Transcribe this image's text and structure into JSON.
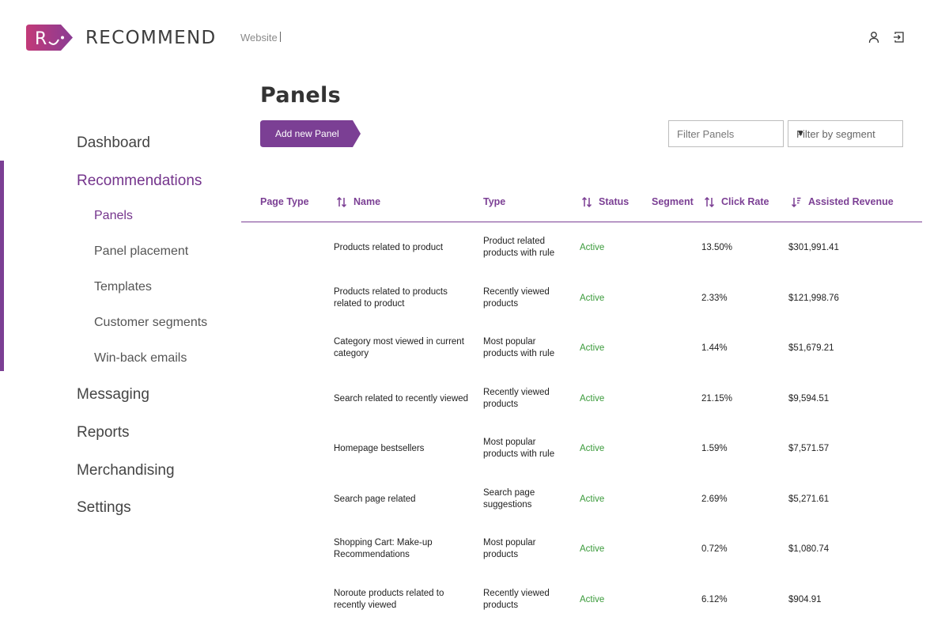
{
  "brand": {
    "logo_letter": "R",
    "name": "RECOMMEND"
  },
  "header": {
    "website_label": "Website"
  },
  "icons": {
    "user": "user-icon",
    "logout": "logout-icon",
    "sort": "sort-icon"
  },
  "colors": {
    "accent": "#7b3f94",
    "status_active": "#3a9a3a"
  },
  "sidebar": {
    "items": [
      {
        "label": "Dashboard"
      },
      {
        "label": "Recommendations",
        "active": true
      },
      {
        "label": "Messaging"
      },
      {
        "label": "Reports"
      },
      {
        "label": "Merchandising"
      },
      {
        "label": "Settings"
      }
    ],
    "subitems": [
      {
        "label": "Panels",
        "active": true
      },
      {
        "label": "Panel placement"
      },
      {
        "label": "Templates"
      },
      {
        "label": "Customer segments"
      },
      {
        "label": "Win-back emails"
      }
    ]
  },
  "main": {
    "title": "Panels",
    "add_button": "Add new Panel",
    "filter_placeholder": "Filter Panels",
    "segment_filter": {
      "selected": "Filter by segment",
      "caret": "▼"
    }
  },
  "table": {
    "columns": {
      "page_type": "Page Type",
      "name": "Name",
      "type": "Type",
      "status": "Status",
      "segment": "Segment",
      "click_rate": "Click Rate",
      "assisted_revenue": "Assisted Revenue"
    },
    "rows": [
      {
        "name": "Products related to product",
        "type": "Product related products with rule",
        "status": "Active",
        "click_rate": "13.50%",
        "revenue": "$301,991.41"
      },
      {
        "name": "Products related to products related to product",
        "type": "Recently viewed products",
        "status": "Active",
        "click_rate": "2.33%",
        "revenue": "$121,998.76"
      },
      {
        "name": "Category most viewed in current category",
        "type": "Most popular products with rule",
        "status": "Active",
        "click_rate": "1.44%",
        "revenue": "$51,679.21"
      },
      {
        "name": "Search related to recently viewed",
        "type": "Recently viewed products",
        "status": "Active",
        "click_rate": "21.15%",
        "revenue": "$9,594.51"
      },
      {
        "name": "Homepage bestsellers",
        "type": "Most popular products with rule",
        "status": "Active",
        "click_rate": "1.59%",
        "revenue": "$7,571.57"
      },
      {
        "name": "Search page related",
        "type": "Search page suggestions",
        "status": "Active",
        "click_rate": "2.69%",
        "revenue": "$5,271.61"
      },
      {
        "name": "Shopping Cart: Make-up Recommendations",
        "type": "Most popular products",
        "status": "Active",
        "click_rate": "0.72%",
        "revenue": "$1,080.74"
      },
      {
        "name": "Noroute products related to recently viewed",
        "type": "Recently viewed products",
        "status": "Active",
        "click_rate": "6.12%",
        "revenue": "$904.91"
      }
    ]
  }
}
